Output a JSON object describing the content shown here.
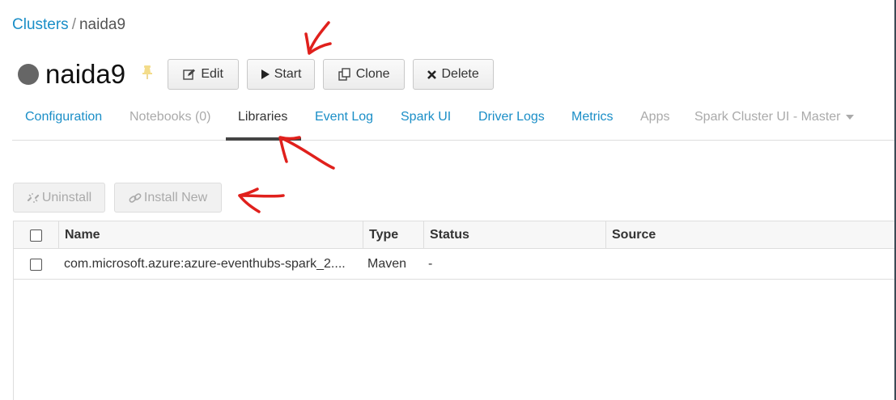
{
  "breadcrumb": {
    "parent": "Clusters",
    "separator": "/",
    "current": "naida9"
  },
  "cluster": {
    "name": "naida9",
    "status_color": "#666666"
  },
  "actions": {
    "edit": "Edit",
    "start": "Start",
    "clone": "Clone",
    "delete": "Delete"
  },
  "tabs": [
    {
      "label": "Configuration",
      "state": "link"
    },
    {
      "label": "Notebooks (0)",
      "state": "disabled"
    },
    {
      "label": "Libraries",
      "state": "active"
    },
    {
      "label": "Event Log",
      "state": "link"
    },
    {
      "label": "Spark UI",
      "state": "link"
    },
    {
      "label": "Driver Logs",
      "state": "link"
    },
    {
      "label": "Metrics",
      "state": "link"
    },
    {
      "label": "Apps",
      "state": "disabled"
    },
    {
      "label": "Spark Cluster UI - Master",
      "state": "disabled"
    }
  ],
  "library_actions": {
    "uninstall": "Uninstall",
    "install_new": "Install New"
  },
  "table": {
    "columns": [
      "Name",
      "Type",
      "Status",
      "Source"
    ],
    "rows": [
      {
        "name": "com.microsoft.azure:azure-eventhubs-spark_2....",
        "type": "Maven",
        "status": "-",
        "source": ""
      }
    ]
  },
  "colors": {
    "link": "#1a8ec7",
    "annotation": "#e0201c",
    "active_tab_underline": "#444444"
  }
}
